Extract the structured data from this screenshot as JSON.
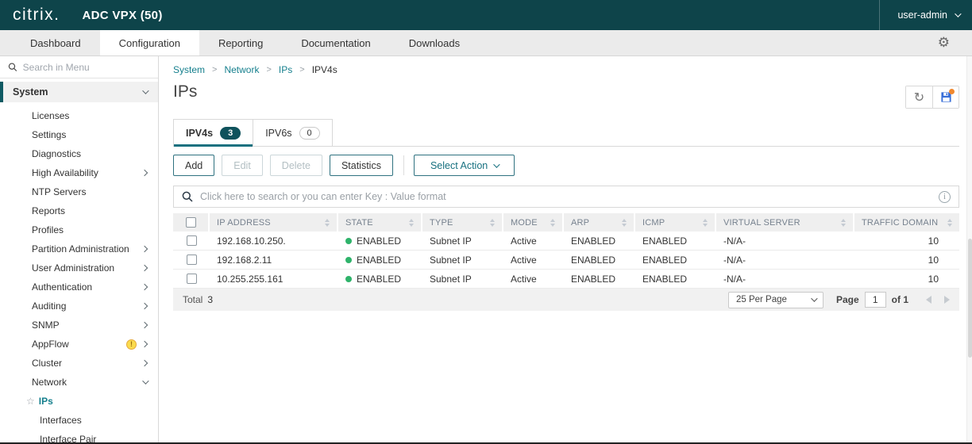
{
  "header": {
    "brand": "citrix.",
    "product": "ADC VPX (50)",
    "user": "user-admin"
  },
  "nav": {
    "tabs": [
      "Dashboard",
      "Configuration",
      "Reporting",
      "Documentation",
      "Downloads"
    ],
    "active_tab": "Configuration"
  },
  "sidebar": {
    "search_placeholder": "Search in Menu",
    "items": [
      {
        "label": "System",
        "level": 1,
        "expanded": true
      },
      {
        "label": "Licenses",
        "level": 2
      },
      {
        "label": "Settings",
        "level": 2
      },
      {
        "label": "Diagnostics",
        "level": 2
      },
      {
        "label": "High Availability",
        "level": 2,
        "has_children": true
      },
      {
        "label": "NTP Servers",
        "level": 2
      },
      {
        "label": "Reports",
        "level": 2
      },
      {
        "label": "Profiles",
        "level": 2
      },
      {
        "label": "Partition Administration",
        "level": 2,
        "has_children": true
      },
      {
        "label": "User Administration",
        "level": 2,
        "has_children": true
      },
      {
        "label": "Authentication",
        "level": 2,
        "has_children": true
      },
      {
        "label": "Auditing",
        "level": 2,
        "has_children": true
      },
      {
        "label": "SNMP",
        "level": 2,
        "has_children": true
      },
      {
        "label": "AppFlow",
        "level": 2,
        "has_children": true,
        "warning": true
      },
      {
        "label": "Cluster",
        "level": 2,
        "has_children": true
      },
      {
        "label": "Network",
        "level": 2,
        "expanded": true
      },
      {
        "label": "IPs",
        "level": 3,
        "selected": true,
        "starred": true
      },
      {
        "label": "Interfaces",
        "level": 3
      },
      {
        "label": "Interface Pair",
        "level": 3
      }
    ]
  },
  "breadcrumb": [
    "System",
    "Network",
    "IPs",
    "IPV4s"
  ],
  "page": {
    "title": "IPs"
  },
  "tabs": [
    {
      "label": "IPV4s",
      "count": "3",
      "active": true
    },
    {
      "label": "IPV6s",
      "count": "0",
      "active": false
    }
  ],
  "toolbar": {
    "add": "Add",
    "edit": "Edit",
    "delete": "Delete",
    "statistics": "Statistics",
    "select_action": "Select Action"
  },
  "search": {
    "placeholder": "Click here to search or you can enter Key : Value format"
  },
  "table": {
    "columns": [
      "IP ADDRESS",
      "STATE",
      "TYPE",
      "MODE",
      "ARP",
      "ICMP",
      "VIRTUAL SERVER",
      "TRAFFIC DOMAIN"
    ],
    "rows": [
      {
        "ip": "192.168.10.250.",
        "state": "ENABLED",
        "type": "Subnet IP",
        "mode": "Active",
        "arp": "ENABLED",
        "icmp": "ENABLED",
        "virtual_server": "-N/A-",
        "traffic_domain": "10"
      },
      {
        "ip": "192.168.2.11",
        "state": "ENABLED",
        "type": "Subnet IP",
        "mode": "Active",
        "arp": "ENABLED",
        "icmp": "ENABLED",
        "virtual_server": "-N/A-",
        "traffic_domain": "10"
      },
      {
        "ip": "10.255.255.161",
        "state": "ENABLED",
        "type": "Subnet IP",
        "mode": "Active",
        "arp": "ENABLED",
        "icmp": "ENABLED",
        "virtual_server": "-N/A-",
        "traffic_domain": "10"
      }
    ]
  },
  "pagination": {
    "total_label": "Total",
    "total": "3",
    "per_page": "25 Per Page",
    "page_label": "Page",
    "page_value": "1",
    "of_label": "of 1"
  },
  "icons": {
    "gear": "⚙",
    "refresh": "↻",
    "star": "☆",
    "warning": "!",
    "info": "i"
  },
  "colors": {
    "header_bg": "#0e444a",
    "accent_teal": "#157f8d",
    "badge_teal": "#0f525c",
    "status_green": "#2eb36a",
    "save_blue": "#3a6fd8",
    "notification_orange": "#f0882e",
    "warning_yellow": "#fadb4e"
  }
}
